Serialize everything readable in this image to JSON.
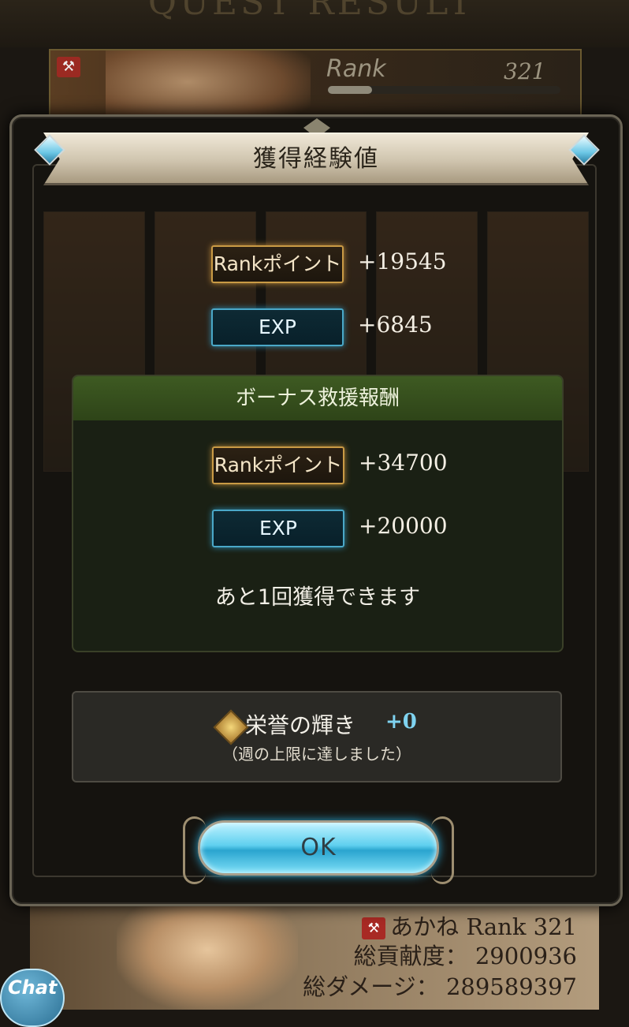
{
  "background": {
    "title": "QUEST RESULT",
    "rank_panel": {
      "label": "Rank",
      "value": "321",
      "progress": 0.19
    },
    "bottom_card": {
      "name_rank": "あかね Rank 321",
      "contribution": "総貢献度： 2900936",
      "damage": "総ダメージ： 289589397"
    },
    "chat_label": "Chat"
  },
  "modal": {
    "title": "獲得経験値",
    "rewards": [
      {
        "label": "Rankポイント",
        "value": "+19545"
      },
      {
        "label": "EXP",
        "value": "+6845"
      }
    ],
    "bonus": {
      "title": "ボーナス救援報酬",
      "rewards": [
        {
          "label": "Rankポイント",
          "value": "+34700"
        },
        {
          "label": "EXP",
          "value": "+20000"
        }
      ],
      "note": "あと1回獲得できます"
    },
    "honor": {
      "label": "栄誉の輝き",
      "value": "+0",
      "sub": "（週の上限に達しました）"
    },
    "ok_label": "OK"
  },
  "colors": {
    "rank_pill_border": "#c99a45",
    "exp_pill_border": "#4aa8c8",
    "bonus_header": "#3e5a22",
    "honor_value": "#7fd3f0"
  }
}
